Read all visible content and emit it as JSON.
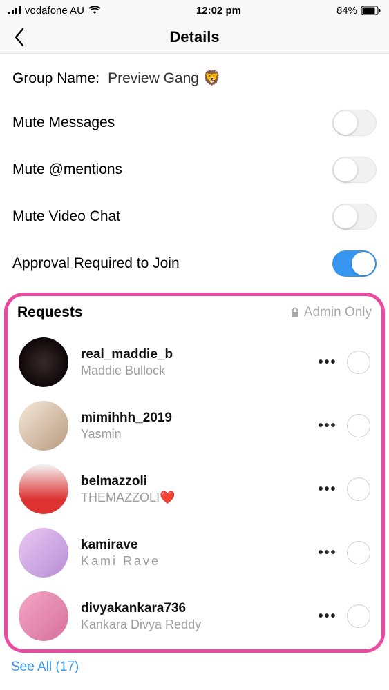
{
  "statusbar": {
    "carrier": "vodafone AU",
    "time": "12:02 pm",
    "battery_pct": "84%"
  },
  "navbar": {
    "title": "Details"
  },
  "group_name": {
    "label": "Group Name:",
    "value": "Preview Gang 🦁"
  },
  "settings": {
    "mute_messages": {
      "label": "Mute Messages",
      "on": false
    },
    "mute_mentions": {
      "label": "Mute @mentions",
      "on": false
    },
    "mute_video": {
      "label": "Mute Video Chat",
      "on": false
    },
    "approval_required": {
      "label": "Approval Required to Join",
      "on": true
    }
  },
  "requests": {
    "heading": "Requests",
    "admin_only": "Admin Only",
    "items": [
      {
        "username": "real_maddie_b",
        "fullname": "Maddie Bullock"
      },
      {
        "username": "mimihhh_2019",
        "fullname": "Yasmin"
      },
      {
        "username": "belmazzoli",
        "fullname": "THEMAZZOLI❤️"
      },
      {
        "username": "kamirave",
        "fullname": "Kami Rave",
        "spaced": true
      },
      {
        "username": "divyakankara736",
        "fullname": "Kankara Divya Reddy"
      }
    ],
    "see_all": "See All (17)"
  },
  "more_glyph": "•••"
}
